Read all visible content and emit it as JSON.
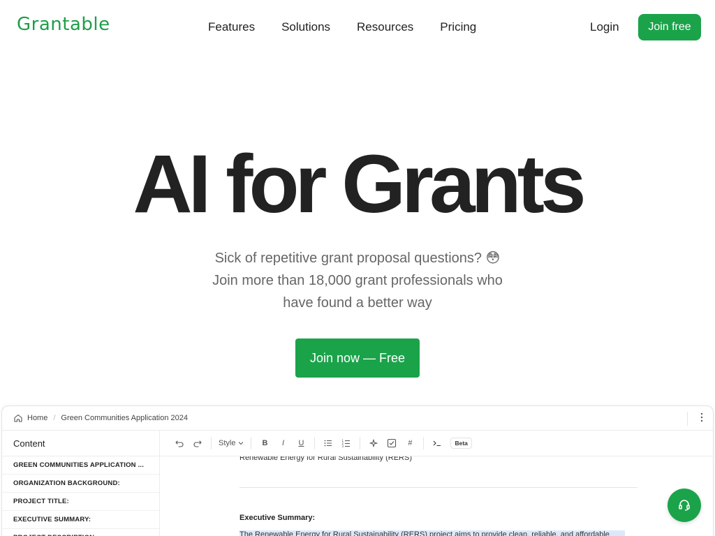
{
  "brand": {
    "name": "Grantable",
    "accent_color": "#1ba34a"
  },
  "nav": {
    "items": [
      {
        "label": "Features"
      },
      {
        "label": "Solutions"
      },
      {
        "label": "Resources"
      },
      {
        "label": "Pricing"
      }
    ],
    "login_label": "Login",
    "join_label": "Join free"
  },
  "hero": {
    "title": "AI for Grants",
    "subtitle_lines": [
      "Sick of repetitive grant proposal questions? 😳",
      "Join more than 18,000 grant professionals who",
      "have found a better way"
    ],
    "cta_label": "Join now — Free"
  },
  "app_preview": {
    "breadcrumb": {
      "home": "Home",
      "document": "Green Communities Application 2024"
    },
    "sidebar": {
      "title": "Content",
      "items": [
        {
          "label": "GREEN COMMUNITIES APPLICATION ..."
        },
        {
          "label": "ORGANIZATION BACKGROUND:"
        },
        {
          "label": "PROJECT TITLE:"
        },
        {
          "label": "EXECUTIVE SUMMARY:"
        },
        {
          "label": "PROJECT DESCRIPTION:"
        }
      ]
    },
    "toolbar": {
      "style_label": "Style",
      "bold": "B",
      "italic": "I",
      "underline": "U",
      "hash": "#",
      "beta_label": "Beta"
    },
    "editor": {
      "project_line": "Renewable Energy for Rural Sustainability (RERS)",
      "heading": "Executive Summary:",
      "paragraph": "The Renewable Energy for Rural Sustainability (RERS) project aims to provide clean, reliable, and affordable"
    }
  },
  "icons": {
    "home": "home-icon",
    "more": "more-vertical-icon",
    "undo": "undo-icon",
    "redo": "redo-icon",
    "chevron": "chevron-down-icon",
    "bullet_list": "bullet-list-icon",
    "numbered_list": "numbered-list-icon",
    "sparkle": "ai-sparkle-icon",
    "checkbox": "checkbox-icon",
    "terminal": "terminal-icon",
    "support": "headset-icon"
  }
}
